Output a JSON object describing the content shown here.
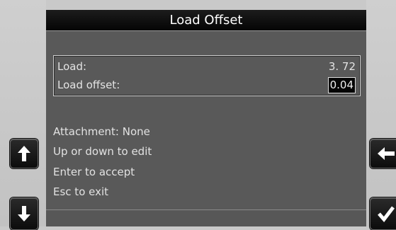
{
  "title": "Load Offset",
  "readout": {
    "load_label": "Load:",
    "load_value": "3. 72",
    "offset_label": "Load offset:",
    "offset_value": "0.04"
  },
  "info": {
    "attachment": "Attachment: None",
    "updown": "Up or down to edit",
    "enter": "Enter to accept",
    "esc": "Esc to exit"
  },
  "buttons": {
    "up": "arrow-up-icon",
    "down": "arrow-down-icon",
    "back": "arrow-left-icon",
    "ok": "checkmark-icon"
  }
}
